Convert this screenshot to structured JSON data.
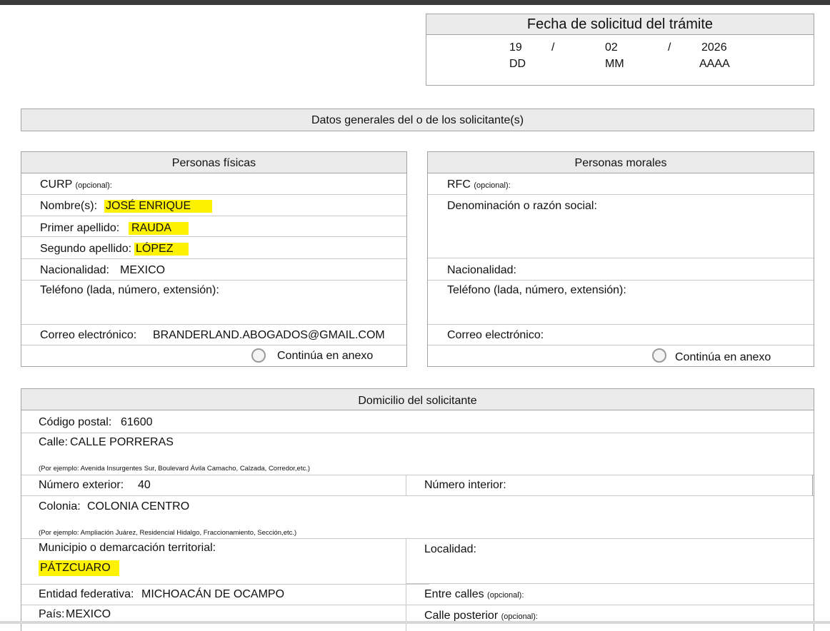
{
  "fecha": {
    "title": "Fecha de solicitud del trámite",
    "day": "19",
    "month": "02",
    "year": "2026",
    "sep1": "/",
    "sep2": "/",
    "day_label": "DD",
    "month_label": "MM",
    "year_label": "AAAA"
  },
  "datos_generales": {
    "title": "Datos generales del o de los solicitante(s)"
  },
  "personas_fisicas": {
    "title": "Personas físicas",
    "curp_label": "CURP",
    "curp_note": "(opcional):",
    "nombre_label": "Nombre(s):",
    "nombre_value": "JOSÉ ENRIQUE",
    "primer_label": "Primer apellido:",
    "primer_value": "RAUDA",
    "segundo_label": "Segundo apellido:",
    "segundo_value": "LÓPEZ",
    "nacionalidad_label": "Nacionalidad:",
    "nacionalidad_value": "MEXICO",
    "telefono_label": "Teléfono (lada, número, extensión):",
    "correo_label": "Correo electrónico:",
    "correo_value": "BRANDERLAND.ABOGADOS@GMAIL.COM",
    "anexo_label": "Continúa en anexo"
  },
  "personas_morales": {
    "title": "Personas morales",
    "rfc_label": "RFC",
    "rfc_note": "(opcional):",
    "denominacion_label": "Denominación o razón social:",
    "nacionalidad_label": "Nacionalidad:",
    "telefono_label": "Teléfono (lada, número, extensión):",
    "correo_label": "Correo electrónico:",
    "anexo_label": "Continúa en anexo"
  },
  "domicilio": {
    "title": "Domicilio del solicitante",
    "cp_label": "Código postal:",
    "cp_value": "61600",
    "calle_label": "Calle:",
    "calle_value": "CALLE PORRERAS",
    "calle_example": "(Por ejemplo: Avenida Insurgentes Sur, Boulevard Ávila Camacho, Calzada, Corredor,etc.)",
    "num_ext_label": "Número exterior:",
    "num_ext_value": "40",
    "num_int_label": "Número interior:",
    "colonia_label": "Colonia:",
    "colonia_value": "COLONIA CENTRO",
    "colonia_example": "(Por ejemplo: Ampliación Juárez, Residencial Hidalgo, Fraccionamiento, Sección,etc.)",
    "municipio_label": "Municipio o demarcación territorial:",
    "municipio_value": "PÁTZCUARO",
    "localidad_label": "Localidad:",
    "entidad_label": "Entidad federativa:",
    "entidad_value": "MICHOACÁN DE OCAMPO",
    "entre_label": "Entre calles",
    "entre_note": "(opcional):",
    "pais_label": "País:",
    "pais_value": "MEXICO",
    "posterior_label": "Calle posterior",
    "posterior_note": "(opcional):"
  },
  "colors": {
    "highlight": "#fff200",
    "header_bg": "#ebebeb",
    "border": "#a3a3a3"
  }
}
